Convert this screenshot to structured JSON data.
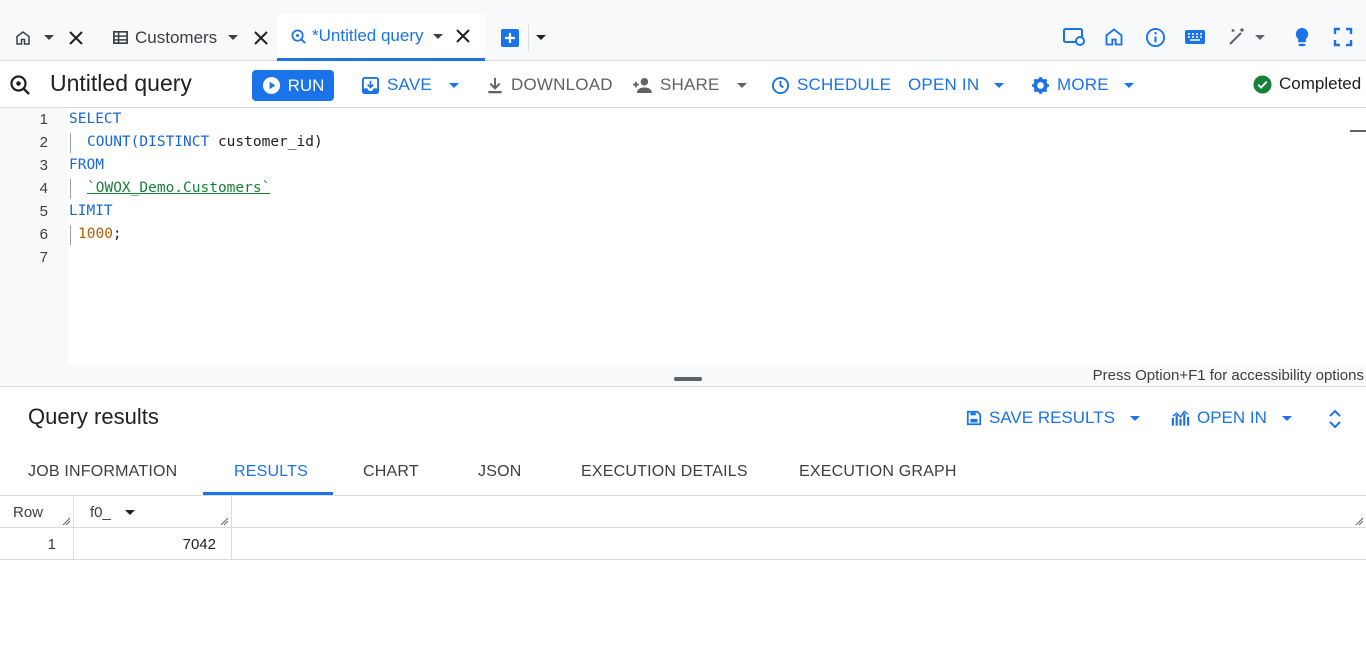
{
  "tabs": [
    {
      "label": "Customers",
      "icon": "table-icon"
    },
    {
      "label": "*Untitled query",
      "icon": "query-icon",
      "active": true
    }
  ],
  "toolbar": {
    "title": "Untitled query",
    "run_label": "RUN",
    "save_label": "SAVE",
    "download_label": "DOWNLOAD",
    "share_label": "SHARE",
    "schedule_label": "SCHEDULE",
    "open_in_label": "OPEN IN",
    "more_label": "MORE",
    "status_label": "Completed"
  },
  "editor": {
    "lines": [
      "1",
      "2",
      "3",
      "4",
      "5",
      "6",
      "7"
    ],
    "code": {
      "select": "SELECT",
      "count_fn": "COUNT(DISTINCT",
      "column": "customer_id)",
      "from": "FROM",
      "table": "`OWOX_Demo.Customers`",
      "limit": "LIMIT",
      "limit_value": "1000",
      "semicolon": ";"
    },
    "accessibility_hint": "Press Option+F1 for accessibility options"
  },
  "results": {
    "title": "Query results",
    "save_results_label": "SAVE RESULTS",
    "open_in_label": "OPEN IN",
    "tabs": [
      "JOB INFORMATION",
      "RESULTS",
      "CHART",
      "JSON",
      "EXECUTION DETAILS",
      "EXECUTION GRAPH"
    ],
    "active_tab": "RESULTS",
    "columns": [
      "Row",
      "f0_"
    ],
    "rows": [
      {
        "row": "1",
        "f0_": "7042"
      }
    ]
  },
  "colors": {
    "accent": "#1a73e8",
    "success": "#188038",
    "keyword": "#1967d2",
    "string": "#188038",
    "number": "#b06000"
  }
}
